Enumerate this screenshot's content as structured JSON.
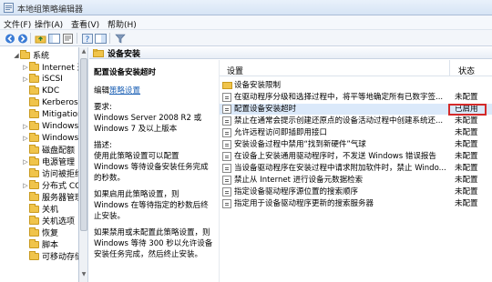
{
  "window": {
    "title": "本地组策略编辑器"
  },
  "menu": [
    "文件(F)",
    "操作(A)",
    "查看(V)",
    "帮助(H)"
  ],
  "toolbar": {
    "icons": [
      "back-icon",
      "forward-icon",
      "up-folder-icon",
      "show-tree-icon",
      "properties-icon",
      "help-icon",
      "toggle-pane-icon",
      "filter-icon"
    ]
  },
  "tree": {
    "items": [
      {
        "label": "系统",
        "expander": "◢"
      },
      {
        "label": "Internet 通",
        "expander": "▷"
      },
      {
        "label": "iSCSI",
        "expander": "▷"
      },
      {
        "label": "KDC",
        "expander": ""
      },
      {
        "label": "Kerberos",
        "expander": ""
      },
      {
        "label": "Mitigation",
        "expander": ""
      },
      {
        "label": "Windows E",
        "expander": "▷"
      },
      {
        "label": "Windows 7",
        "expander": "▷"
      },
      {
        "label": "磁盘配额",
        "expander": ""
      },
      {
        "label": "电源管理",
        "expander": "▷"
      },
      {
        "label": "访问被拒绝",
        "expander": ""
      },
      {
        "label": "分布式 COM",
        "expander": "▷"
      },
      {
        "label": "服务器管理",
        "expander": ""
      },
      {
        "label": "关机",
        "expander": ""
      },
      {
        "label": "关机选项",
        "expander": ""
      },
      {
        "label": "恢复",
        "expander": ""
      },
      {
        "label": "脚本",
        "expander": ""
      },
      {
        "label": "可移动存储",
        "expander": ""
      }
    ]
  },
  "right_pane": {
    "header": "设备安装",
    "description": {
      "title": "配置设备安装超时",
      "edit_prefix": "编辑",
      "edit_link": "策略设置",
      "requirements_label": "要求:",
      "requirements": "Windows Server 2008 R2 或 Windows 7 及以上版本",
      "desc_label": "描述:",
      "desc_text": "使用此策略设置可以配置 Windows 等待设备安装任务完成的秒数。",
      "enabled_text": "如果启用此策略设置，则 Windows 在等待指定的秒数后终止安装。",
      "disabled_text": "如果禁用或未配置此策略设置，则 Windows 等待 300 秒以允许设备安装任务完成，然后终止安装。"
    },
    "list": {
      "columns": {
        "setting": "设置",
        "state": "状态"
      },
      "rows": [
        {
          "name": "设备安装限制",
          "state": "",
          "type": "folder"
        },
        {
          "name": "在驱动程序分级和选择过程中，将平等地确定所有已数字签...",
          "state": "未配置",
          "type": "policy"
        },
        {
          "name": "配置设备安装超时",
          "state": "已启用",
          "type": "policy"
        },
        {
          "name": "禁止在通常会提示创建还原点的设备活动过程中创建系统还...",
          "state": "未配置",
          "type": "policy"
        },
        {
          "name": "允许远程访问即插即用接口",
          "state": "未配置",
          "type": "policy"
        },
        {
          "name": "安装设备过程中禁用“找到新硬件”气球",
          "state": "未配置",
          "type": "policy"
        },
        {
          "name": "在设备上安装通用驱动程序时，不发送 Windows 错误报告",
          "state": "未配置",
          "type": "policy"
        },
        {
          "name": "当设备驱动程序在安装过程中请求附加软件时，禁止 Windo...",
          "state": "未配置",
          "type": "policy"
        },
        {
          "name": "禁止从 Internet 进行设备元数据检索",
          "state": "未配置",
          "type": "policy"
        },
        {
          "name": "指定设备驱动程序源位置的搜索顺序",
          "state": "未配置",
          "type": "policy"
        },
        {
          "name": "指定用于设备驱动程序更新的搜索服务器",
          "state": "未配置",
          "type": "policy"
        }
      ]
    }
  },
  "colors": {
    "highlight_box": "#d42a2a",
    "selection": "#dbe9fa",
    "link": "#1a5fb4"
  }
}
